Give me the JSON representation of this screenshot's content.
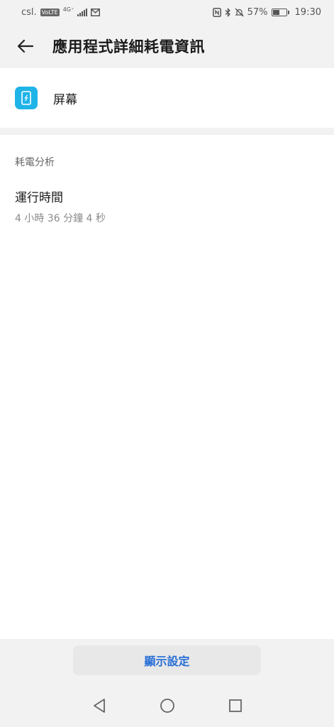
{
  "status_bar": {
    "carrier": "csl.",
    "volte": "VoLTE",
    "network": "4G⁺",
    "battery_percent": "57%",
    "battery_level": 0.57,
    "time": "19:30",
    "icons": [
      "nfc-icon",
      "bluetooth-icon",
      "mute-icon",
      "battery-icon",
      "mail-icon",
      "signal-icon"
    ]
  },
  "app_bar": {
    "title": "應用程式詳細耗電資訊",
    "back_icon": "back-arrow-icon"
  },
  "app_card": {
    "icon": "screen-icon",
    "icon_color": "#1fb4e8",
    "name": "屏幕"
  },
  "analysis": {
    "header": "耗電分析",
    "items": [
      {
        "title": "運行時間",
        "value": "4 小時 36 分鐘 4 秒"
      }
    ]
  },
  "footer": {
    "display_settings_label": "顯示設定",
    "accent": "#2a6fd6"
  },
  "nav_bar": {
    "icons": [
      "nav-back-icon",
      "nav-home-icon",
      "nav-recents-icon"
    ]
  }
}
